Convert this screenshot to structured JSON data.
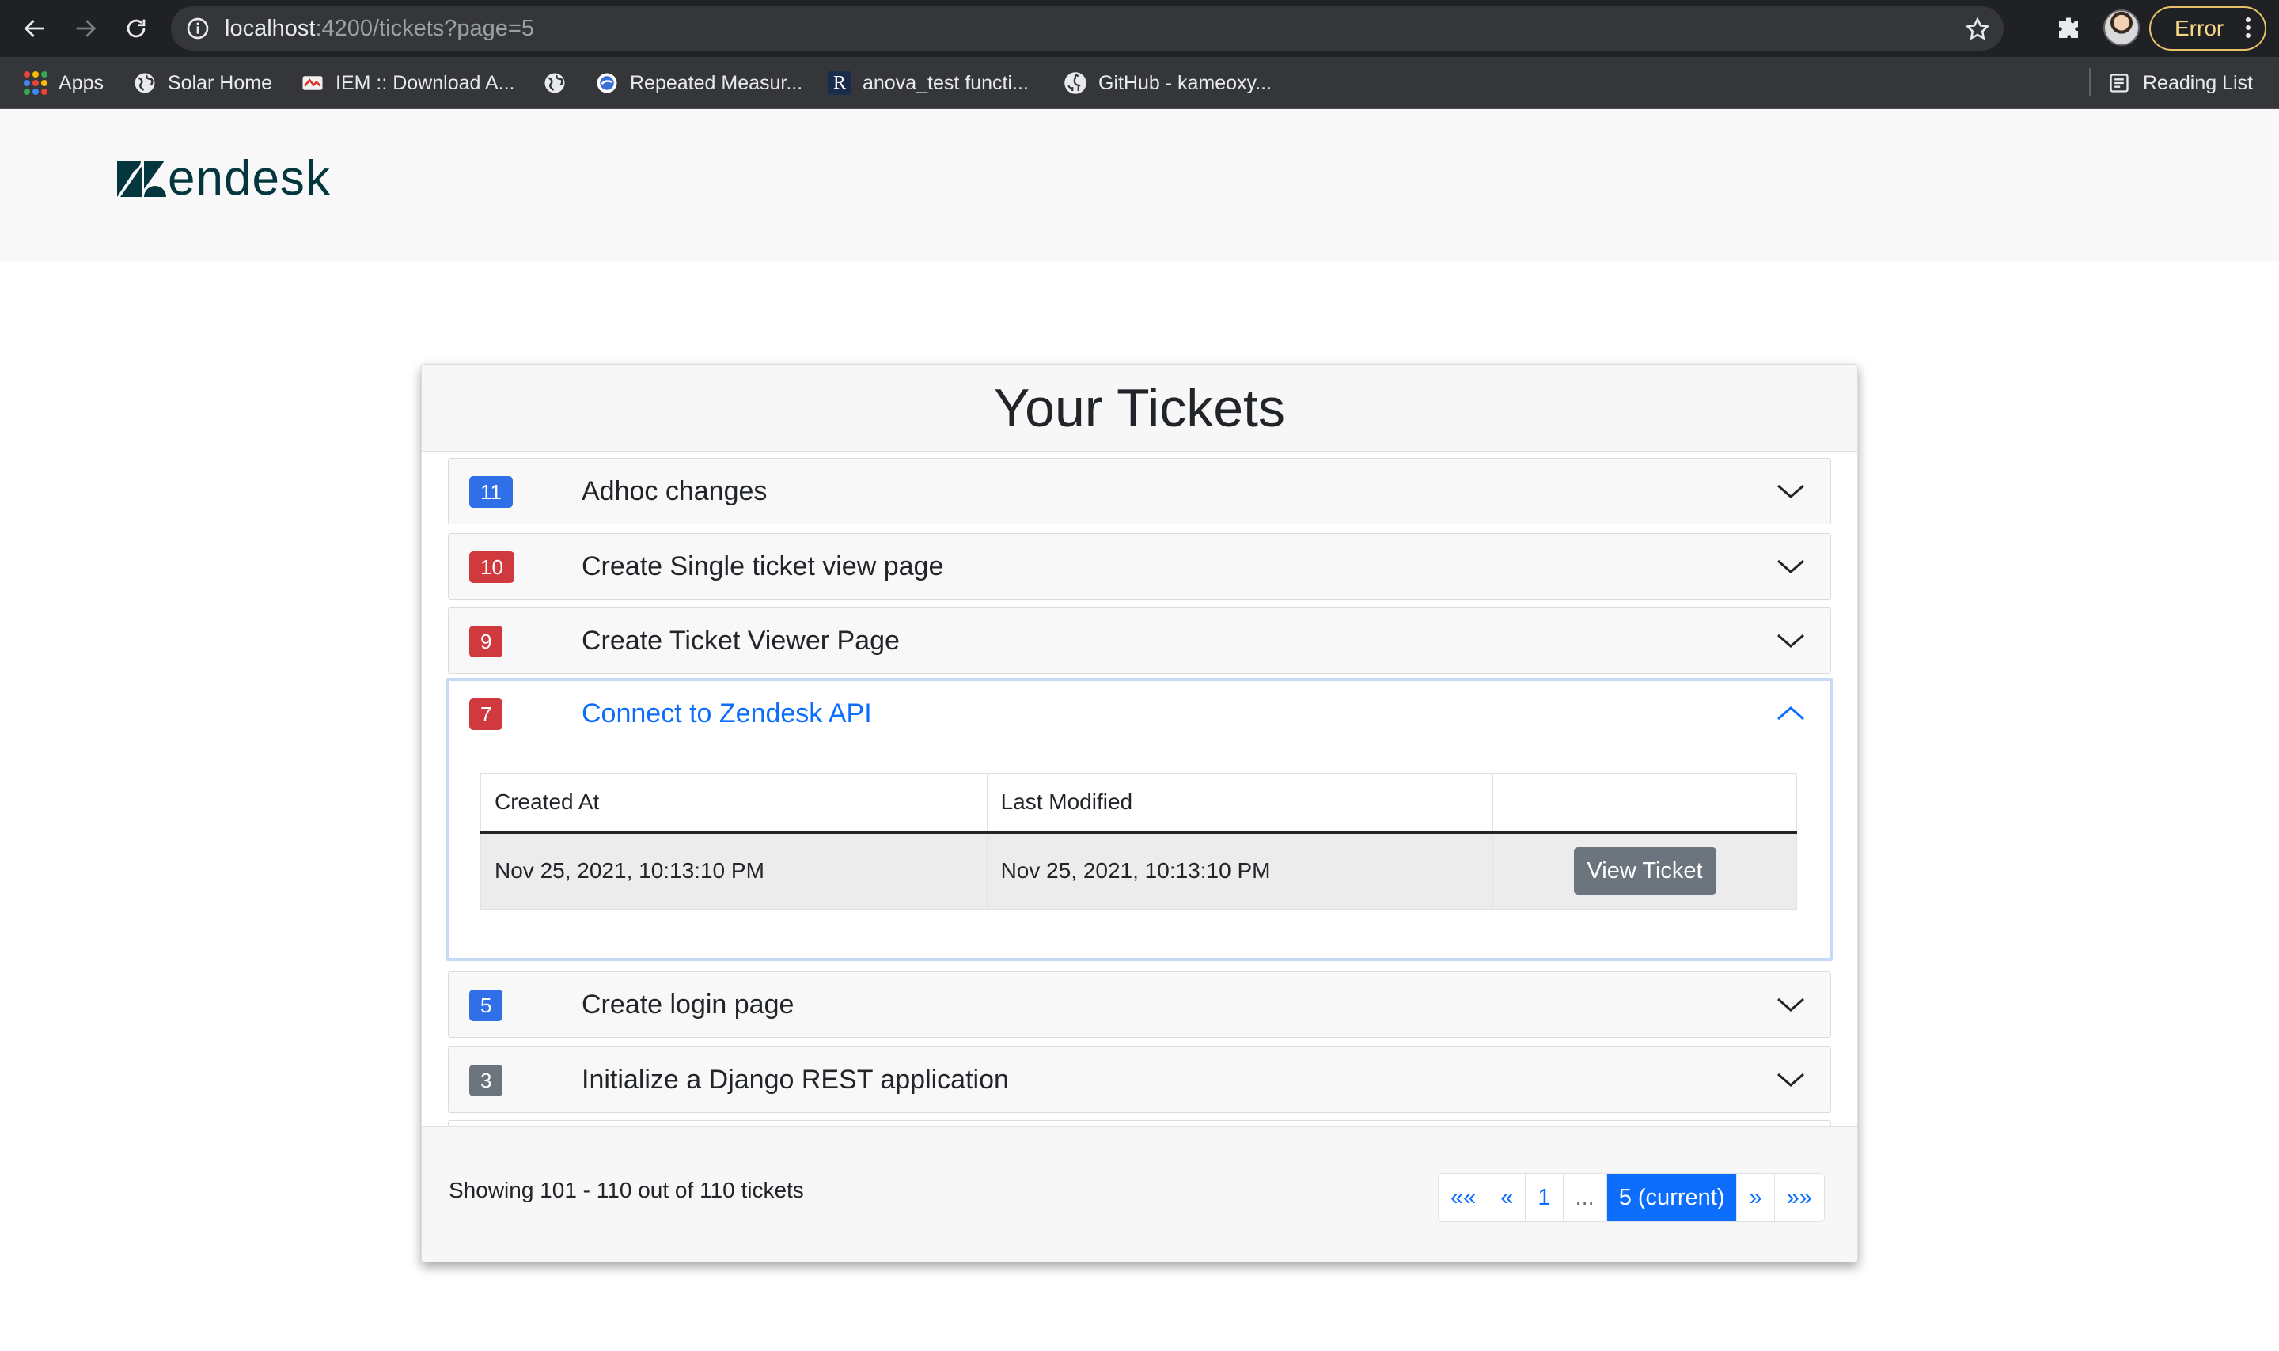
{
  "browser": {
    "url_host": "localhost",
    "url_rest": ":4200/tickets?page=5",
    "profile_status": "Error",
    "bookmarks": [
      {
        "label": "Apps",
        "icon": "apps-grid-icon"
      },
      {
        "label": "Solar Home",
        "icon": "globe-icon"
      },
      {
        "label": "IEM :: Download A...",
        "icon": "site-favicon-icon"
      },
      {
        "label": "",
        "icon": "globe-icon"
      },
      {
        "label": "Repeated Measur...",
        "icon": "site-favicon-icon"
      },
      {
        "label": "anova_test functi...",
        "icon": "r-favicon-icon"
      },
      {
        "label": "GitHub - kameoxy...",
        "icon": "github-icon"
      }
    ],
    "reading_list": "Reading List"
  },
  "header": {
    "logo_text": "endesk"
  },
  "tickets_card": {
    "title": "Your Tickets",
    "tickets": [
      {
        "id": "11",
        "subject": "Adhoc changes",
        "badge_color": "#2f6fe8",
        "open": false
      },
      {
        "id": "10",
        "subject": "Create Single ticket view page",
        "badge_color": "#d0393e",
        "open": false
      },
      {
        "id": "9",
        "subject": "Create Ticket Viewer Page",
        "badge_color": "#d0393e",
        "open": false
      },
      {
        "id": "7",
        "subject": "Connect to Zendesk API",
        "badge_color": "#d0393e",
        "open": true
      },
      {
        "id": "5",
        "subject": "Create login page",
        "badge_color": "#2f6fe8",
        "open": false
      },
      {
        "id": "3",
        "subject": "Initialize a Django REST application",
        "badge_color": "#6c757d",
        "open": false
      }
    ],
    "detail": {
      "headers": [
        "Created At",
        "Last Modified",
        ""
      ],
      "created_at": "Nov 25, 2021, 10:13:10 PM",
      "last_modified": "Nov 25, 2021, 10:13:10 PM",
      "button_label": "View Ticket"
    },
    "footer": {
      "showing": "Showing 101 - 110 out of 110 tickets",
      "pager": [
        "««",
        "«",
        "1",
        "...",
        "5 (current)",
        "»",
        "»»"
      ]
    }
  },
  "colors": {
    "primary": "#0d6efd",
    "danger": "#d0393e",
    "secondary": "#6c757d",
    "zendesk_green": "#03363d"
  }
}
